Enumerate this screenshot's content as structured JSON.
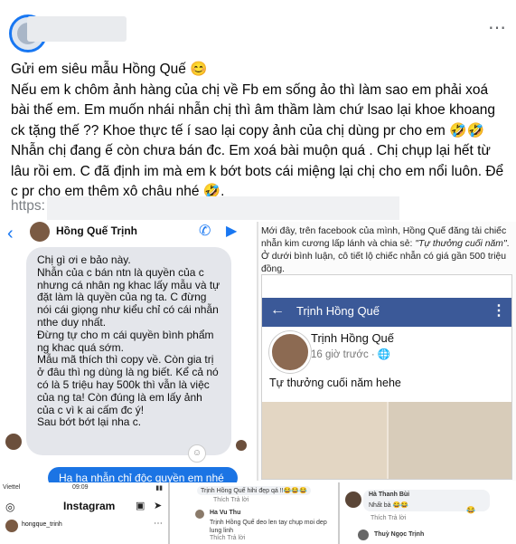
{
  "post": {
    "paragraphs": [
      "Gửi em siêu mẫu Hồng Quế 😊",
      "Nếu em k chôm ảnh hàng của chị về Fb em sống ảo thì làm sao em phải xoá bài thế em. Em muốn nhái nhẫn chị thì âm thầm làm chứ lsao lại khoe khoang ck tặng thế ?? Khoe thực tế í sao lại copy ảnh của chị dùng pr cho em 🤣🤣 Nhẫn chị đang ế còn chưa bán đc. Em xoá bài muộn quá . Chị chụp lại hết từ lâu rồi em. C đã định im mà em k bớt bots cái miệng lại chị cho em nổi luôn. Để c pr cho em thêm xô chậu nhé 🤣."
    ],
    "link_prefix": "https:",
    "more_icon": "⋯"
  },
  "chat": {
    "contact_name": "Hồng Quế Trịnh",
    "message_lines": [
      "Chị gì ơi e bảo này.",
      "Nhẫn của c bán ntn là quyền của c nhưng cá nhân ng khac lấy mẫu và tự đặt làm là quyền của ng ta. C đừng nói cái giọng như kiểu chỉ có cái nhẫn nthe duy nhất.",
      "Đừng tự cho m cái quyền bình phẩm ng khac quá sớm.",
      "Mẫu mã thích thì copy về. Còn gia trị ở đâu thì ng dùng là ng biết. Kể cả nó có là 5 triệu hay 500k thì vẫn là việc của ng ta! Còn đúng là em lấy ảnh của c vì k ai cấm đc ý!",
      "Sau bớt bớt lại nha c."
    ],
    "sent_message": "Ha ha nhẫn chỉ độc quyền em nhé",
    "back_icon": "‹",
    "call_icon": "✆",
    "video_icon": "▶"
  },
  "news": {
    "caption_before": "Mới đây, trên facebook của mình, Hồng Quế đăng tải chiếc nhẫn kim cương lấp lánh và chia sẻ: ",
    "caption_quote": "\"Tự thưởng cuối năm\"",
    "caption_after": ". Ở dưới bình luận, cô tiết lộ chiếc nhẫn có giá gần 500 triệu đồng.",
    "fb_title": "Trịnh Hồng Quế",
    "fb_name": "Trịnh Hồng Quế",
    "fb_time": "16 giờ trước · 🌐",
    "fb_post": "Tự thưởng cuối năm hehe",
    "back_icon": "←",
    "more_icon": "⋮"
  },
  "instagram": {
    "carrier": "Viettel",
    "time": "09:09",
    "battery": "▮▮",
    "title": "Instagram",
    "username": "hongque_trinh",
    "camera_icon": "◎",
    "tv_icon": "▣",
    "send_icon": "➤",
    "dots_icon": "⋯"
  },
  "comments": {
    "c1_text": "Trịnh Hồng Quế hihi đẹp qá !!😂😂😂",
    "c1_actions": "Thích   Trả lời",
    "c2_name": "Ha Vu Thu",
    "c2_text": "Trịnh Hồng Quế deo len tay chụp moi dep lung linh",
    "c2_actions": "Thích   Trả lời"
  },
  "comments2": {
    "d1_name": "Hà Thanh Bùi",
    "d1_text": "Nhất bà 😂😂",
    "d1_react": "😂",
    "d1_actions": "Thích   Trả lời",
    "d2_name": "Thuỳ Ngọc Trịnh"
  }
}
